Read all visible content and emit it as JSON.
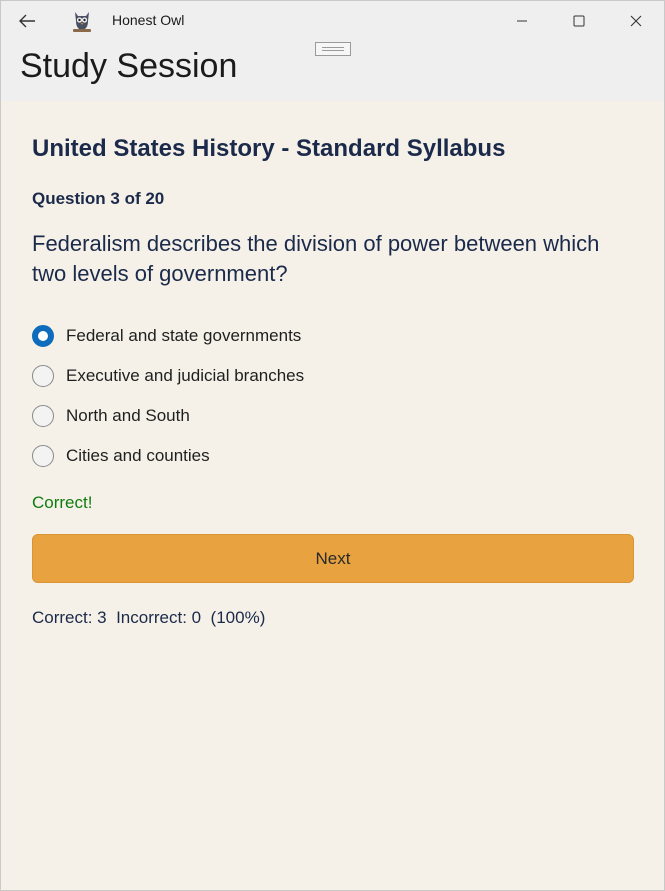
{
  "window": {
    "app_title": "Honest Owl",
    "icons": {
      "back": "back-arrow-icon",
      "app": "owl-app-icon",
      "minimize": "minimize-icon",
      "maximize": "maximize-icon",
      "close": "close-icon"
    }
  },
  "header": {
    "title": "Study Session"
  },
  "quiz": {
    "course_title": "United States History - Standard Syllabus",
    "question_count": "Question 3 of 20",
    "question_text": "Federalism describes the division of power between which two levels of government?",
    "options": [
      {
        "label": "Federal and state governments",
        "selected": true
      },
      {
        "label": "Executive and judicial branches",
        "selected": false
      },
      {
        "label": "North and South",
        "selected": false
      },
      {
        "label": "Cities and counties",
        "selected": false
      }
    ],
    "feedback": "Correct!",
    "next_label": "Next",
    "score": "Correct: 3  Incorrect: 0  (100%)"
  },
  "colors": {
    "accent": "#0f6cbd",
    "button": "#e8a23f",
    "success": "#107c10",
    "background": "#f5f1e8",
    "heading": "#1b2a4a"
  }
}
